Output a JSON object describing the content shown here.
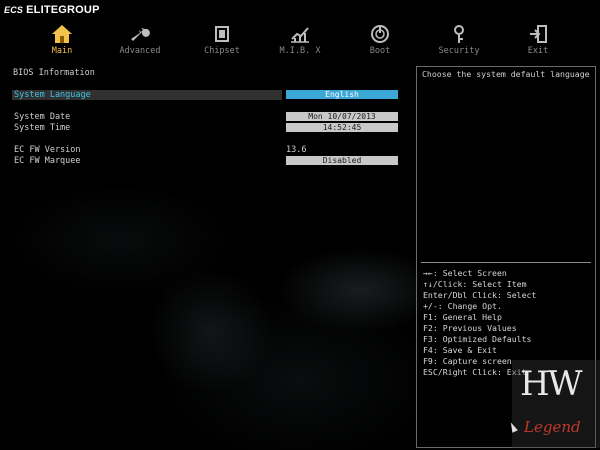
{
  "brand": {
    "ecs": "ECS",
    "name": "ELITEGROUP"
  },
  "nav": {
    "items": [
      {
        "label": "Main",
        "icon": "home-icon",
        "active": true
      },
      {
        "label": "Advanced",
        "icon": "wrench-icon"
      },
      {
        "label": "Chipset",
        "icon": "chip-icon"
      },
      {
        "label": "M.I.B. X",
        "icon": "chart-icon"
      },
      {
        "label": "Boot",
        "icon": "power-icon"
      },
      {
        "label": "Security",
        "icon": "key-icon"
      },
      {
        "label": "Exit",
        "icon": "exit-icon"
      }
    ]
  },
  "main": {
    "section_title": "BIOS Information",
    "rows": [
      {
        "label": "System Language",
        "value": "English",
        "selected": true
      },
      {
        "label": "System Date",
        "value": "Mon 10/07/2013"
      },
      {
        "label": "System Time",
        "value": "14:52:45"
      },
      {
        "label": "EC FW Version",
        "value": "13.6"
      },
      {
        "label": "EC FW Marquee",
        "value": "Disabled"
      }
    ]
  },
  "help": {
    "description": "Choose the system default language",
    "keys": [
      "→←: Select Screen",
      "↑↓/Click: Select Item",
      "Enter/Dbl Click: Select",
      "+/-: Change Opt.",
      "F1: General Help",
      "F2: Previous Values",
      "F3: Optimized Defaults",
      "F4: Save & Exit",
      "F9: Capture screen",
      "ESC/Right Click: Exit"
    ]
  },
  "watermark": {
    "top": "HW",
    "bottom": "Legend"
  },
  "colors": {
    "accent": "#3aa7d6",
    "selected_label": "#3fc3e6",
    "active_tab": "#f5c04a"
  }
}
